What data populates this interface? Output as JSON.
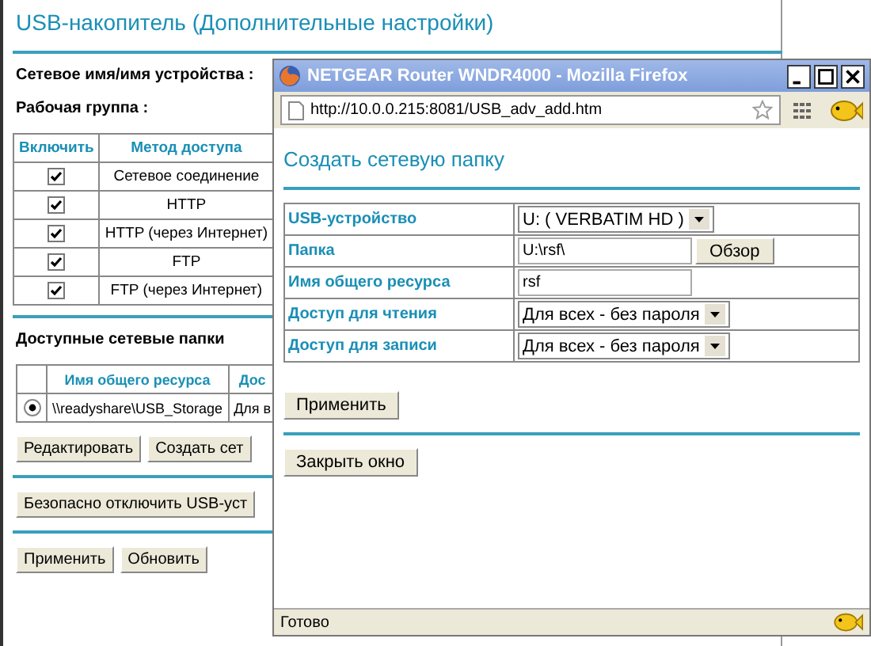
{
  "page": {
    "title": "USB-накопитель (Дополнительные настройки)",
    "fields": [
      "Сетевое имя/имя устройства :",
      "Рабочая группа :"
    ],
    "access_table": {
      "columns": [
        "Включить",
        "Метод доступа"
      ],
      "rows": [
        {
          "enabled": true,
          "method": "Сетевое соединение"
        },
        {
          "enabled": true,
          "method": "HTTP"
        },
        {
          "enabled": true,
          "method": "HTTP (через Интернет)"
        },
        {
          "enabled": true,
          "method": "FTP"
        },
        {
          "enabled": true,
          "method": "FTP (через Интернет)"
        }
      ]
    },
    "shares": {
      "heading": "Доступные сетевые папки",
      "columns": [
        "Имя общего ресурса",
        "Дос"
      ],
      "rows": [
        {
          "selected": true,
          "cells": [
            "\\\\readyshare\\USB_Storage",
            "Для в"
          ]
        }
      ]
    },
    "button_groups": [
      [
        "Редактировать",
        "Создать сет"
      ],
      [
        "Безопасно отключить USB-уст"
      ],
      [
        "Применить",
        "Обновить"
      ]
    ]
  },
  "popup": {
    "title": "NETGEAR Router WNDR4000 - Mozilla Firefox",
    "url": "http://10.0.0.215:8081/USB_adv_add.htm",
    "heading": "Создать сетевую папку",
    "form": [
      {
        "label": "USB-устройство",
        "kind": "select",
        "value": "U: ( VERBATIM HD )"
      },
      {
        "label": "Папка",
        "kind": "browse",
        "value": "U:\\rsf\\",
        "button": "Обзор"
      },
      {
        "label": "Имя общего ресурса",
        "kind": "input",
        "value": "rsf"
      },
      {
        "label": "Доступ для чтения",
        "kind": "select",
        "value": "Для всех - без пароля"
      },
      {
        "label": "Доступ для записи",
        "kind": "select",
        "value": "Для всех - без пароля"
      }
    ],
    "apply": "Применить",
    "close": "Закрыть окно",
    "status": "Готово"
  }
}
